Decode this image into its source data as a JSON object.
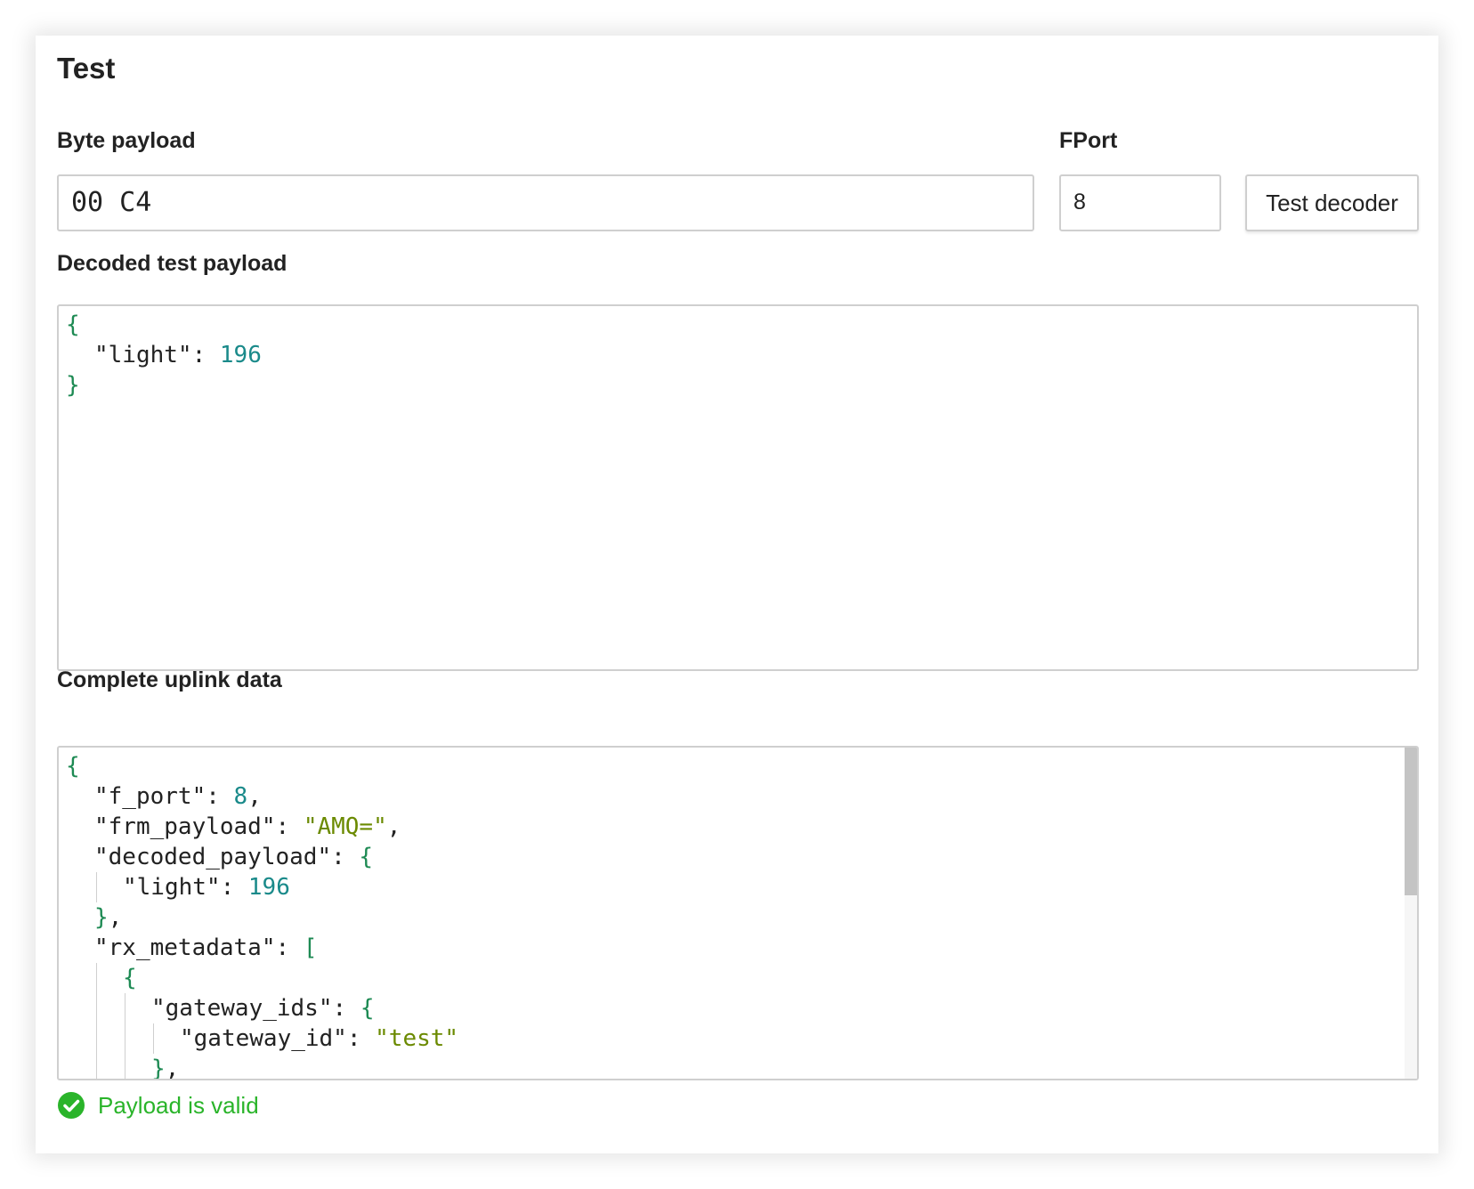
{
  "card": {
    "title": "Test"
  },
  "byte_payload": {
    "label": "Byte payload",
    "value": "00 C4"
  },
  "fport": {
    "label": "FPort",
    "value": "8"
  },
  "test_button": {
    "label": "Test decoder"
  },
  "decoded": {
    "label": "Decoded test payload",
    "lines": [
      [
        "{"
      ],
      [
        "\"light\": ",
        "196"
      ],
      [
        "}"
      ]
    ]
  },
  "uplink": {
    "label": "Complete uplink data",
    "lines": [
      [
        "{"
      ],
      [
        "\"f_port\": ",
        "8",
        ","
      ],
      [
        "\"frm_payload\": ",
        "\"AMQ=\"",
        ","
      ],
      [
        "\"decoded_payload\": ",
        "{"
      ],
      [
        "\"light\": ",
        "196"
      ],
      [
        "}",
        ","
      ],
      [
        "\"rx_metadata\": ",
        "["
      ],
      [
        "{"
      ],
      [
        "\"gateway_ids\": ",
        "{"
      ],
      [
        "\"gateway_id\": ",
        "\"test\""
      ],
      [
        "}",
        ","
      ]
    ]
  },
  "status": {
    "message": "Payload is valid",
    "icon": "check-circle-icon",
    "color": "#2ab42a"
  },
  "colors": {
    "punct": "#1d8a53",
    "number": "#1a8a8a",
    "string": "#6b8a00"
  }
}
